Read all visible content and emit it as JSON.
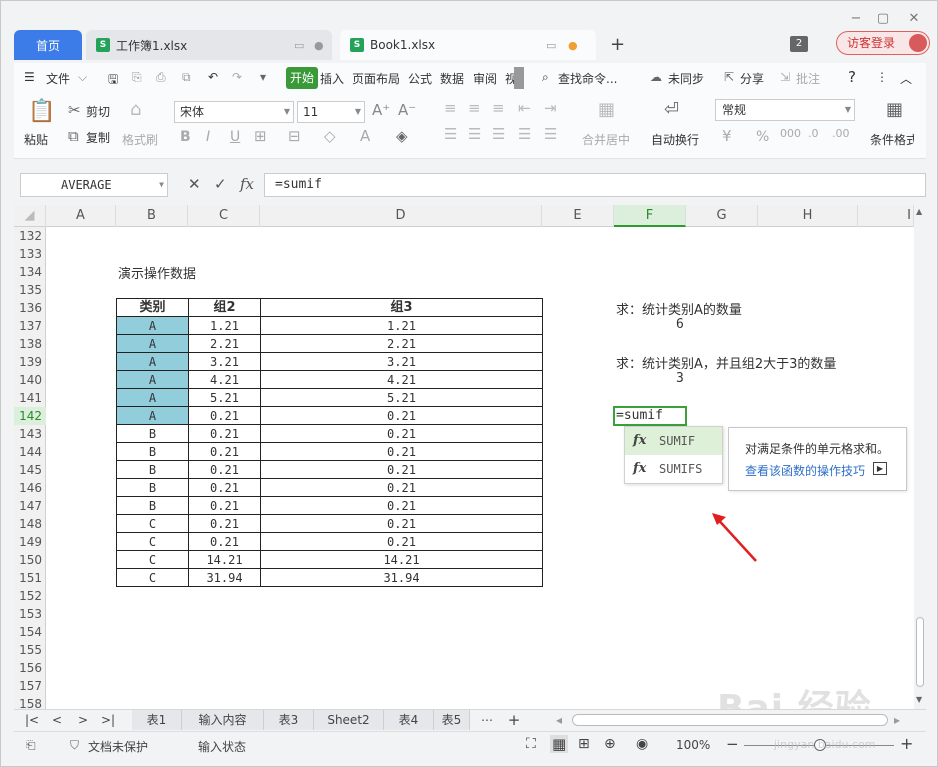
{
  "window": {
    "min": "−",
    "max": "▢",
    "close": "✕"
  },
  "tabs": {
    "home": "首页",
    "doc1": "工作簿1.xlsx",
    "doc2": "Book1.xlsx",
    "add": "+",
    "count": "2",
    "login": "访客登录"
  },
  "menu": {
    "file": "文件",
    "items": [
      "开始",
      "插入",
      "页面布局",
      "公式",
      "数据",
      "审阅",
      "视"
    ],
    "search": "查找命令...",
    "sync": "未同步",
    "share": "分享",
    "comment": "批注",
    "help": "?",
    "more": "⋮",
    "collapse": "︿"
  },
  "ribbon": {
    "paste": "粘贴",
    "cut": "剪切",
    "copy": "复制",
    "format_painter": "格式刷",
    "font": "宋体",
    "size": "11",
    "bold": "B",
    "italic": "I",
    "underline": "U",
    "merge": "合并居中",
    "wrap": "自动换行",
    "number_format": "常规",
    "percent": "%",
    "cond_format": "条件格式"
  },
  "formula_bar": {
    "name_box": "AVERAGE",
    "fx": "fx",
    "formula": "=sumif"
  },
  "columns": [
    "A",
    "B",
    "C",
    "D",
    "E",
    "F",
    "G",
    "H",
    "I"
  ],
  "active_column": "F",
  "rows": [
    "132",
    "133",
    "134",
    "135",
    "136",
    "137",
    "138",
    "139",
    "140",
    "141",
    "142",
    "143",
    "144",
    "145",
    "146",
    "147",
    "148",
    "149",
    "150",
    "151",
    "152",
    "153",
    "154",
    "155",
    "156",
    "157",
    "158"
  ],
  "active_row": "142",
  "sheet_title": "演示操作数据",
  "table": {
    "headers": [
      "类别",
      "组2",
      "组3"
    ],
    "rows": [
      [
        "A",
        "1.21",
        "1.21"
      ],
      [
        "A",
        "2.21",
        "2.21"
      ],
      [
        "A",
        "3.21",
        "3.21"
      ],
      [
        "A",
        "4.21",
        "4.21"
      ],
      [
        "A",
        "5.21",
        "5.21"
      ],
      [
        "A",
        "0.21",
        "0.21"
      ],
      [
        "B",
        "0.21",
        "0.21"
      ],
      [
        "B",
        "0.21",
        "0.21"
      ],
      [
        "B",
        "0.21",
        "0.21"
      ],
      [
        "B",
        "0.21",
        "0.21"
      ],
      [
        "B",
        "0.21",
        "0.21"
      ],
      [
        "C",
        "0.21",
        "0.21"
      ],
      [
        "C",
        "0.21",
        "0.21"
      ],
      [
        "C",
        "14.21",
        "14.21"
      ],
      [
        "C",
        "31.94",
        "31.94"
      ]
    ],
    "highlight_color": "#92cddc"
  },
  "questions": {
    "q1": "求：统计类别A的数量",
    "a1": "6",
    "q2": "求：统计类别A，并且组2大于3的数量",
    "a2": "3"
  },
  "editing_cell": "=sumif",
  "autocomplete": {
    "items": [
      "SUMIF",
      "SUMIFS"
    ],
    "selected": "SUMIF",
    "tip": "对满足条件的单元格求和。",
    "link": "查看该函数的操作技巧"
  },
  "sheets": [
    "表1",
    "输入内容",
    "表3",
    "Sheet2",
    "表4",
    "表5"
  ],
  "status": {
    "protect": "文档未保护",
    "input_state": "输入状态",
    "zoom": "100%"
  },
  "watermark": {
    "main": "Bai 经验",
    "sub": "jingyan.baidu.com"
  },
  "colors": {
    "accent_green": "#3aa03a",
    "home_tab": "#3c7ce8",
    "arrow": "#e02020"
  }
}
